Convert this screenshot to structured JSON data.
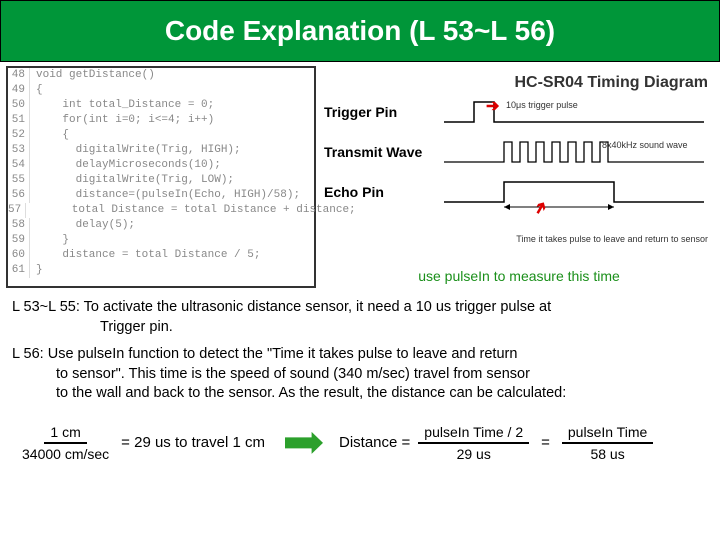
{
  "header": {
    "title": "Code Explanation (L 53~L 56)"
  },
  "code": {
    "lines": [
      {
        "n": "48",
        "t": "void getDistance()"
      },
      {
        "n": "49",
        "t": "{"
      },
      {
        "n": "50",
        "t": "    int total_Distance = 0;"
      },
      {
        "n": "51",
        "t": "    for(int i=0; i<=4; i++)"
      },
      {
        "n": "52",
        "t": "    {"
      },
      {
        "n": "53",
        "t": "      digitalWrite(Trig, HIGH);"
      },
      {
        "n": "54",
        "t": "      delayMicroseconds(10);"
      },
      {
        "n": "55",
        "t": "      digitalWrite(Trig, LOW);"
      },
      {
        "n": "56",
        "t": "      distance=(pulseIn(Echo, HIGH)/58);"
      },
      {
        "n": "57",
        "t": "      total Distance = total Distance + distance;"
      },
      {
        "n": "58",
        "t": "      delay(5);"
      },
      {
        "n": "59",
        "t": "    }"
      },
      {
        "n": "60",
        "t": "    distance = total Distance / 5;"
      },
      {
        "n": "61",
        "t": "}"
      }
    ]
  },
  "diagram": {
    "title": "HC-SR04 Timing Diagram",
    "row1": {
      "label": "Trigger Pin",
      "note": "10μs trigger pulse"
    },
    "row2": {
      "label": "Transmit Wave",
      "note": "8x40kHz sound wave"
    },
    "row3": {
      "label": "Echo Pin",
      "note": "Time it takes pulse to leave and return to sensor"
    },
    "caption": "use pulseIn to measure this time"
  },
  "explain": {
    "p1a": "L 53~L 55:  To activate the ultrasonic distance sensor, it need a 10 us trigger pulse at",
    "p1b": "Trigger pin.",
    "p2a": "L 56: Use pulseIn function to detect the \"Time it takes pulse to leave and return",
    "p2b": "to sensor\".  This time is the speed of sound (340 m/sec) travel from sensor",
    "p2c": "to the wall and back to the sensor.  As the result, the distance can be calculated:"
  },
  "formula": {
    "f1_num": "1 cm",
    "f1_den": "34000 cm/sec",
    "eq1": "= 29 us to travel 1 cm",
    "dist_label": "Distance =",
    "f2_num": "pulseIn Time / 2",
    "f2_den": "29 us",
    "eq2": "=",
    "f3_num": "pulseIn Time",
    "f3_den": "58 us"
  }
}
